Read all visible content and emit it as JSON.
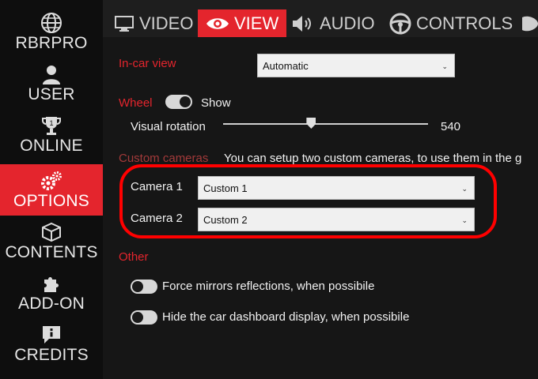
{
  "sidebar": {
    "items": [
      {
        "label": "RBRPRO",
        "icon": "globe-icon"
      },
      {
        "label": "USER",
        "icon": "user-icon"
      },
      {
        "label": "ONLINE",
        "icon": "trophy-icon"
      },
      {
        "label": "OPTIONS",
        "icon": "gears-icon"
      },
      {
        "label": "CONTENTS",
        "icon": "box-icon"
      },
      {
        "label": "ADD-ON",
        "icon": "puzzle-icon"
      },
      {
        "label": "CREDITS",
        "icon": "chat-info-icon"
      }
    ],
    "active": "OPTIONS"
  },
  "tabs": [
    {
      "label": "VIDEO",
      "icon": "monitor-icon"
    },
    {
      "label": "VIEW",
      "icon": "eye-icon"
    },
    {
      "label": "AUDIO",
      "icon": "speaker-icon"
    },
    {
      "label": "CONTROLS",
      "icon": "steering-wheel-icon"
    }
  ],
  "active_tab": "VIEW",
  "view": {
    "incar_label": "In-car view",
    "incar_value": "Automatic",
    "wheel_label": "Wheel",
    "wheel_show_label": "Show",
    "visual_rotation_label": "Visual rotation",
    "visual_rotation_value": "540",
    "visual_rotation_fraction": 0.43,
    "custom_cameras_label": "Custom cameras",
    "custom_cameras_text": "You can setup two custom cameras, to use them in the g",
    "camera1_label": "Camera 1",
    "camera1_value": "Custom 1",
    "camera2_label": "Camera 2",
    "camera2_value": "Custom 2",
    "other_label": "Other",
    "force_mirrors_label": "Force mirrors reflections, when possibile",
    "hide_dashboard_label": "Hide the car dashboard display, when possibile"
  },
  "colors": {
    "accent": "#e4252d",
    "highlight": "#ff0000"
  }
}
